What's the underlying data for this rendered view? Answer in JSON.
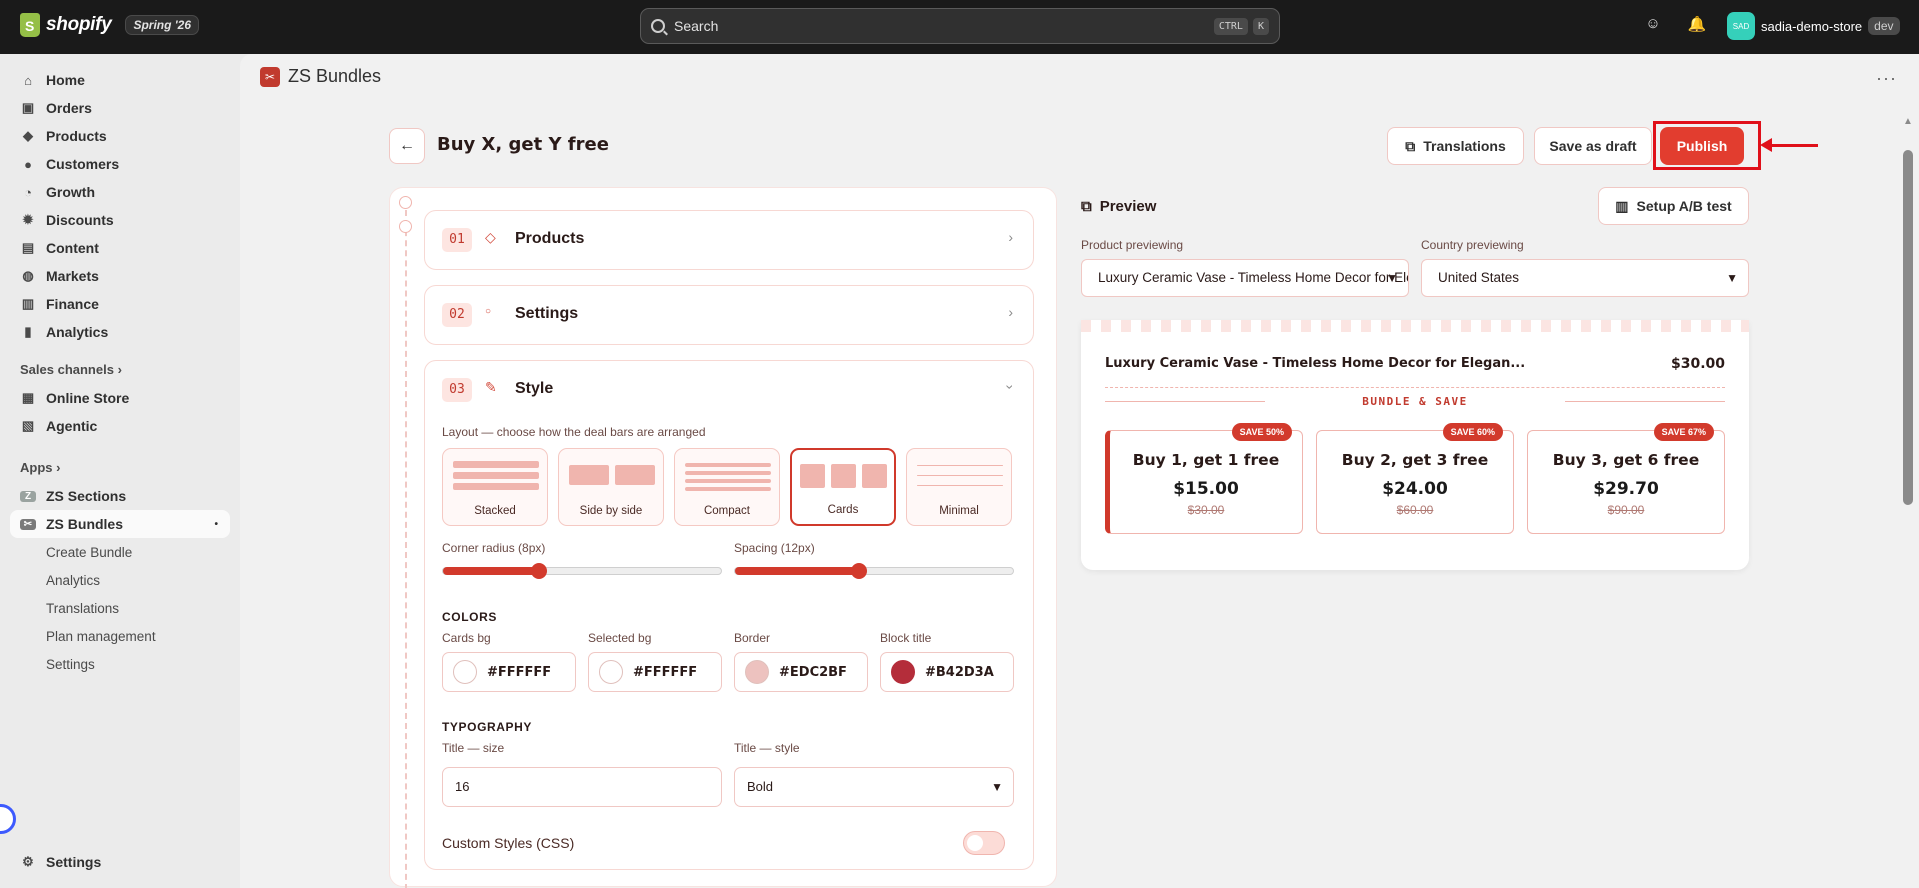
{
  "topbar": {
    "brand": "shopify",
    "edition": "Spring '26",
    "search_label": "Search",
    "kbd1": "CTRL",
    "kbd2": "K",
    "store_initials": "SAD",
    "store_name": "sadia-demo-store",
    "env": "dev"
  },
  "sidebar": {
    "items": [
      {
        "label": "Home",
        "icon": "home-icon"
      },
      {
        "label": "Orders",
        "icon": "inbox-icon"
      },
      {
        "label": "Products",
        "icon": "tag-icon"
      },
      {
        "label": "Customers",
        "icon": "person-icon"
      },
      {
        "label": "Growth",
        "icon": "growth-icon"
      },
      {
        "label": "Discounts",
        "icon": "discount-icon"
      },
      {
        "label": "Content",
        "icon": "content-icon"
      },
      {
        "label": "Markets",
        "icon": "globe-icon"
      },
      {
        "label": "Finance",
        "icon": "bank-icon"
      },
      {
        "label": "Analytics",
        "icon": "chart-icon"
      }
    ],
    "sales_channels_label": "Sales channels",
    "channels": [
      "Online Store",
      "Agentic"
    ],
    "apps_label": "Apps",
    "apps": [
      "ZS Sections",
      "ZS Bundles"
    ],
    "app_subitems": [
      "Create Bundle",
      "Analytics",
      "Translations",
      "Plan management",
      "Settings"
    ],
    "settings_label": "Settings"
  },
  "app": {
    "name": "ZS Bundles",
    "page_title": "Buy X, get Y free",
    "translations_label": "Translations",
    "save_draft_label": "Save as draft",
    "publish_label": "Publish"
  },
  "steps": [
    {
      "num": "01",
      "title": "Products"
    },
    {
      "num": "02",
      "title": "Settings"
    },
    {
      "num": "03",
      "title": "Style"
    }
  ],
  "style": {
    "layout_label": "Layout — choose how the deal bars are arranged",
    "layouts": [
      "Stacked",
      "Side by side",
      "Compact",
      "Cards",
      "Minimal"
    ],
    "selected_layout": "Cards",
    "corner_radius_label": "Corner radius (8px)",
    "corner_radius_value": 8,
    "spacing_label": "Spacing (12px)",
    "spacing_value": 12,
    "colors_heading": "COLORS",
    "colors": [
      {
        "label": "Cards bg",
        "value": "#FFFFFF"
      },
      {
        "label": "Selected bg",
        "value": "#FFFFFF"
      },
      {
        "label": "Border",
        "value": "#EDC2BF"
      },
      {
        "label": "Block title",
        "value": "#B42D3A"
      }
    ],
    "typography_heading": "TYPOGRAPHY",
    "title_size_label": "Title — size",
    "title_size_value": "16",
    "title_style_label": "Title — style",
    "title_style_value": "Bold",
    "custom_css_label": "Custom Styles (CSS)"
  },
  "preview": {
    "heading": "Preview",
    "ab_label": "Setup A/B test",
    "product_label": "Product previewing",
    "product_value": "Luxury Ceramic Vase - Timeless Home Decor for Elegant Living",
    "country_label": "Country previewing",
    "country_value": "United States",
    "product_title": "Luxury Ceramic Vase - Timeless Home Decor for Elegan...",
    "product_price": "$30.00",
    "bundle_label": "BUNDLE & SAVE",
    "offers": [
      {
        "title": "Buy 1, get 1 free",
        "price": "$15.00",
        "original": "$30.00",
        "badge": "SAVE 50%"
      },
      {
        "title": "Buy 2, get 3 free",
        "price": "$24.00",
        "original": "$60.00",
        "badge": "SAVE 60%"
      },
      {
        "title": "Buy 3, get 6 free",
        "price": "$29.70",
        "original": "$90.00",
        "badge": "SAVE 67%"
      }
    ]
  }
}
